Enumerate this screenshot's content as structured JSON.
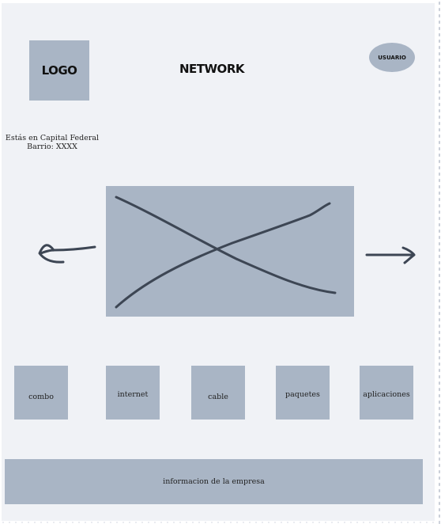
{
  "header": {
    "logo_label": "LOGO",
    "title": "NETWORK",
    "user_label": "USUARIO"
  },
  "location": {
    "line1": "Estás en Capital Federal",
    "line2": "Barrio: XXXX"
  },
  "carousel": {
    "image_placeholder": "image-placeholder-icon",
    "prev_icon": "arrow-left-icon",
    "next_icon": "arrow-right-icon"
  },
  "categories": [
    {
      "label": "combo"
    },
    {
      "label": "internet"
    },
    {
      "label": "cable"
    },
    {
      "label": "paquetes"
    },
    {
      "label": "aplicaciones"
    }
  ],
  "footer": {
    "label": "informacion de la empresa"
  },
  "colors": {
    "background": "#f0f2f6",
    "placeholder": "#a9b5c5",
    "stroke": "#3d4654"
  }
}
